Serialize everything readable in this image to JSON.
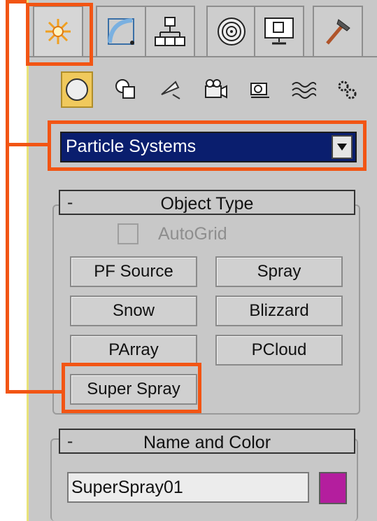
{
  "tabs": [
    {
      "icon": "sun-icon",
      "active": true
    },
    {
      "icon": "curve-shape-icon",
      "active": false
    },
    {
      "icon": "hierarchy-icon",
      "active": false
    },
    {
      "icon": "motion-rings-icon",
      "active": false
    },
    {
      "icon": "display-monitor-icon",
      "active": false
    },
    {
      "icon": "hammer-icon",
      "active": false
    }
  ],
  "subcategories": [
    {
      "icon": "sphere-icon",
      "active": true
    },
    {
      "icon": "shapes-icon",
      "active": false
    },
    {
      "icon": "lights-icon",
      "active": false
    },
    {
      "icon": "cameras-icon",
      "active": false
    },
    {
      "icon": "helpers-icon",
      "active": false
    },
    {
      "icon": "spacewarps-icon",
      "active": false
    },
    {
      "icon": "systems-icon",
      "active": false
    }
  ],
  "dropdown": {
    "value": "Particle Systems"
  },
  "object_type": {
    "header": {
      "minus": "-",
      "title": "Object Type"
    },
    "autogrid_label": "AutoGrid",
    "buttons": {
      "pf_source": "PF Source",
      "spray": "Spray",
      "snow": "Snow",
      "blizzard": "Blizzard",
      "parray": "PArray",
      "pcloud": "PCloud",
      "super_spray": "Super Spray"
    }
  },
  "name_and_color": {
    "header": {
      "minus": "-",
      "title": "Name and Color"
    },
    "name_value": "SuperSpray01",
    "color": "#b41e9e"
  },
  "highlight_color": "#f25514"
}
